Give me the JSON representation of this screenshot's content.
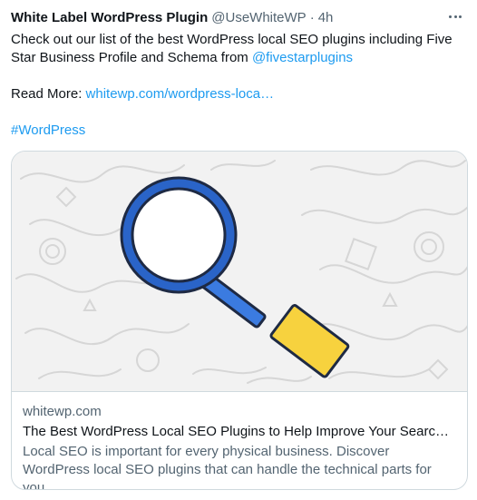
{
  "tweet": {
    "author_name": "White Label WordPress Plugin",
    "author_handle": "@UseWhiteWP",
    "separator": "·",
    "timestamp": "4h",
    "text_part1": "Check out our list of the best WordPress local SEO plugins including Five Star Business Profile and Schema from ",
    "mention": "@fivestarplugins",
    "read_more_label": "Read More: ",
    "read_more_link": "whitewp.com/wordpress-loca…",
    "hashtag": "#WordPress"
  },
  "card": {
    "domain": "whitewp.com",
    "title": "The Best WordPress Local SEO Plugins to Help Improve Your Search R…",
    "description": "Local SEO is important for every physical business. Discover WordPress local SEO plugins that can handle the technical parts for you.",
    "image_icon": "magnifying-glass-icon"
  },
  "colors": {
    "link": "#1d9bf0",
    "secondary_text": "#536471",
    "lens_ring": "#2a64c8",
    "handle_yellow": "#f7d23e"
  }
}
